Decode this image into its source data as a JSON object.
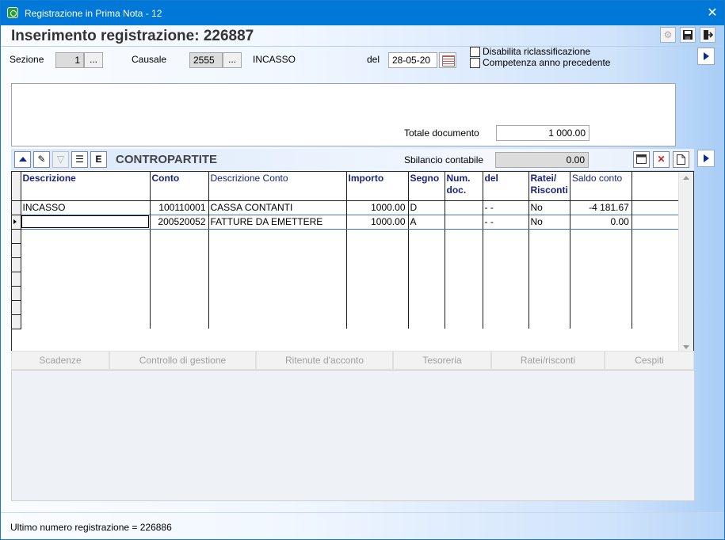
{
  "window": {
    "title": "Registrazione in Prima Nota - 12",
    "close_glyph": "✕"
  },
  "header": {
    "title": "Inserimento registrazione: 226887",
    "icons": [
      "tax-icon",
      "save-icon",
      "exit-icon"
    ]
  },
  "form": {
    "sezione_label": "Sezione",
    "sezione_value": "1",
    "causale_label": "Causale",
    "causale_value": "2555",
    "causale_desc": "INCASSO",
    "del_label": "del",
    "date_value": "28-05-20",
    "ellipsis": "...",
    "check_disabilita": "Disabilita riclassificazione",
    "check_competenza": "Competenza anno precedente",
    "totale_label": "Totale documento",
    "totale_value": "1 000.00"
  },
  "contropartite": {
    "title": "CONTROPARTITE",
    "sbilancio_label": "Sbilancio contabile",
    "sbilancio_value": "0.00",
    "columns": [
      "Descrizione",
      "Conto",
      "Descrizione Conto",
      "Importo",
      "Segno",
      "Num. doc.",
      "del",
      "Ratei/ Risconti",
      "Saldo conto"
    ],
    "rows": [
      {
        "descrizione": "INCASSO",
        "conto": "100110001",
        "descrizione_conto": "CASSA CONTANTI",
        "importo": "1000.00",
        "segno": "D",
        "num_doc": "",
        "del": "-  -",
        "ratei": "No",
        "saldo": "-4 181.67"
      },
      {
        "descrizione": "",
        "conto": "200520052",
        "descrizione_conto": "FATTURE DA EMETTERE",
        "importo": "1000.00",
        "segno": "A",
        "num_doc": "",
        "del": "-  -",
        "ratei": "No",
        "saldo": "0.00"
      }
    ]
  },
  "tabs": [
    "Scadenze",
    "Controllo di gestione",
    "Ritenute d'acconto",
    "Tesoreria",
    "Ratei/risconti",
    "Cespiti"
  ],
  "status": {
    "text": "Ultimo numero registrazione = 226886"
  }
}
